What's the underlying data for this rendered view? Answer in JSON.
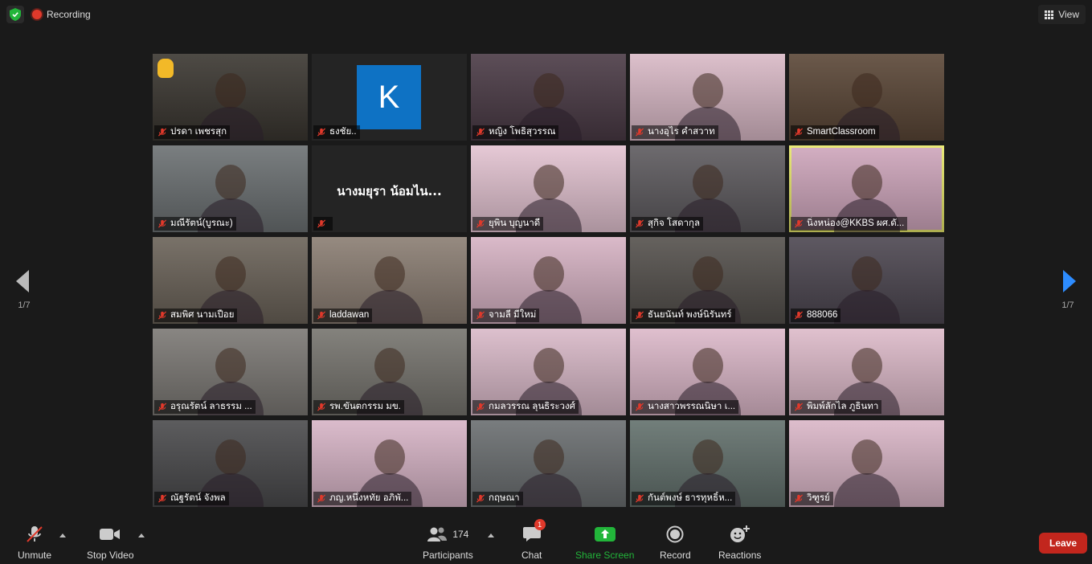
{
  "topbar": {
    "recording_label": "Recording",
    "view_label": "View"
  },
  "grid": {
    "tiles": [
      {
        "name": "ปรดา  เพชรสุก",
        "muted": true,
        "bg": "#3a3630",
        "raised_hand": true
      },
      {
        "name": "ธงชัย..",
        "muted": true,
        "bg": "#242424",
        "avatar_letter": "K"
      },
      {
        "name": "หญิง  โพธิสุวรรณ",
        "muted": true,
        "bg": "#4a3a45"
      },
      {
        "name": "นางอุไร คำสวาท",
        "muted": true,
        "bg": "#d9b9c6"
      },
      {
        "name": "SmartClassroom",
        "muted": true,
        "bg": "#5a4636"
      },
      {
        "name": "มณีรัตน์(บูรณะ)",
        "muted": true,
        "bg": "#6b7072"
      },
      {
        "name": "",
        "muted": true,
        "bg": "#242424",
        "display_name": "นางมยุรา น้อมไน..."
      },
      {
        "name": "ยุพิน บุญนาดี",
        "muted": true,
        "bg": "#e3c3d1"
      },
      {
        "name": "สุกิจ โสดากุล",
        "muted": true,
        "bg": "#5d5a5e"
      },
      {
        "name": "นิ่งหน่อง@KKBS ผศ.ดั...",
        "muted": true,
        "bg": "#cfa6bc",
        "active": true
      },
      {
        "name": "สมพิศ นามเปือย",
        "muted": true,
        "bg": "#6a6258"
      },
      {
        "name": "laddawan",
        "muted": true,
        "bg": "#8a7d72"
      },
      {
        "name": "จามลี มีใหม่",
        "muted": true,
        "bg": "#d6b2c3"
      },
      {
        "name": "ธันยนันท์ พงษ์นิรันทร์",
        "muted": true,
        "bg": "#54504c"
      },
      {
        "name": "888066",
        "muted": true,
        "bg": "#4c4650"
      },
      {
        "name": "อรุณรัตน์  ลาธรรม ...",
        "muted": true,
        "bg": "#7b7874"
      },
      {
        "name": "รพ.ขันตกรรม มข.",
        "muted": true,
        "bg": "#76746e"
      },
      {
        "name": "กมลวรรณ  ลุนธิระวงศ์",
        "muted": true,
        "bg": "#d9b9c8"
      },
      {
        "name": "นางสาวพรรณนิษา เ...",
        "muted": true,
        "bg": "#dcb8c9"
      },
      {
        "name": "พิมพ์ลักไล ภูธินทา",
        "muted": true,
        "bg": "#ddbac9"
      },
      {
        "name": "ณัฐรัตน์ จังพล",
        "muted": true,
        "bg": "#4a4a4c"
      },
      {
        "name": "ภญ.หนึ่งหทัย  อภิพั...",
        "muted": true,
        "bg": "#d7b4c6"
      },
      {
        "name": "กฤษณา",
        "muted": true,
        "bg": "#6a6e70"
      },
      {
        "name": "กันต์พงษ์ ธารทุหธิ์ห...",
        "muted": true,
        "bg": "#62706c"
      },
      {
        "name": "วิฑูรย์",
        "muted": true,
        "bg": "#dab6c7"
      }
    ]
  },
  "nav": {
    "left_page": "1/7",
    "right_page": "1/7"
  },
  "toolbar": {
    "unmute_label": "Unmute",
    "stop_video_label": "Stop Video",
    "participants_label": "Participants",
    "participants_count": "174",
    "chat_label": "Chat",
    "chat_badge": "1",
    "share_label": "Share Screen",
    "record_label": "Record",
    "reactions_label": "Reactions",
    "leave_label": "Leave"
  },
  "colors": {
    "accent_green": "#22b53a",
    "leave_red": "#c2261d",
    "active_speaker": "#e8e86a",
    "nav_blue": "#2d8cff"
  }
}
